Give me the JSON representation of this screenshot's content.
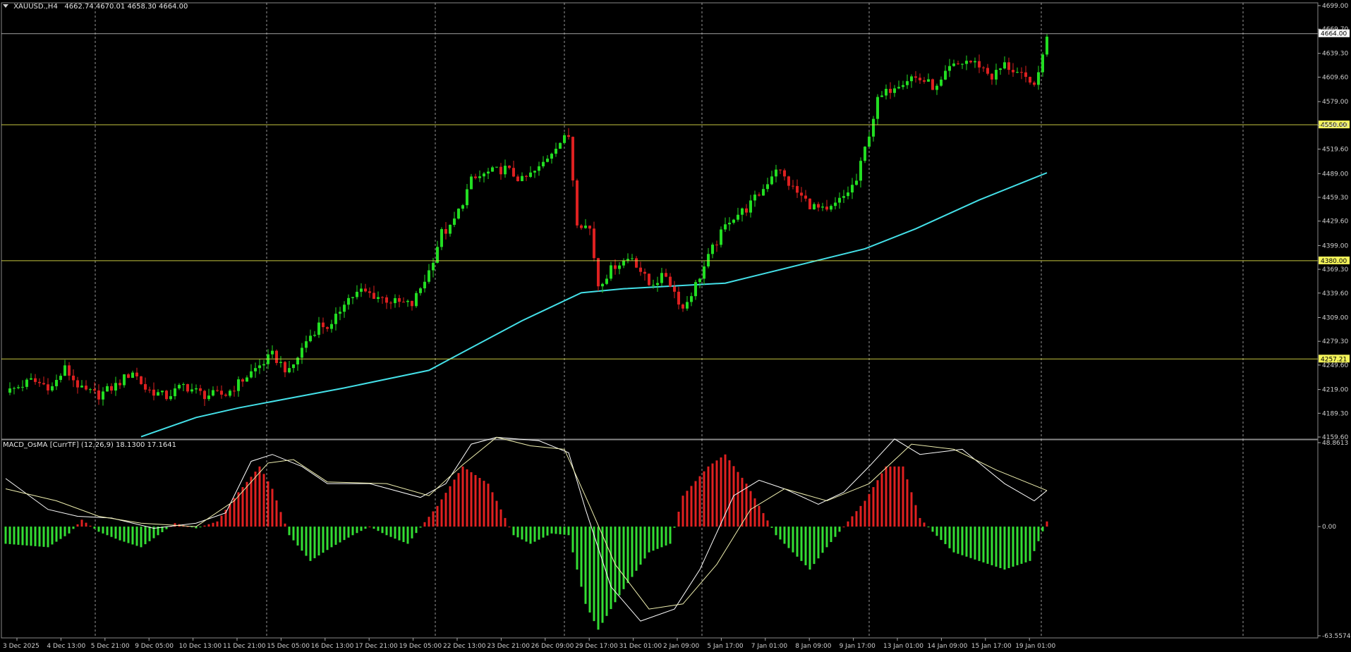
{
  "chart_header": {
    "symbol": "XAUUSD.,H4",
    "ohlc": "4662.74 4670.01 4658.30 4664.00"
  },
  "indicator_header": {
    "label": "MACD_OsMA [CurrTF] (12,26,9) 18.1300 17.1641"
  },
  "colors": {
    "background": "#000000",
    "bull_candle": "#22dd22",
    "bear_candle": "#dd2020",
    "moving_average": "#44e0e8",
    "level_line": "#e8e84a",
    "grid": "#c8c8c8",
    "osma_positive": "#e02020",
    "osma_negative": "#33dd33",
    "macd_line": "#ffffff",
    "signal_line": "#f0f0b0"
  },
  "chart_data": [
    {
      "type": "candlestick",
      "price_axis_ticks": [
        "4699.00",
        "4669.70",
        "4639.30",
        "4609.60",
        "4579.00",
        "4549.40",
        "4519.60",
        "4489.00",
        "4459.30",
        "4429.60",
        "4399.00",
        "4369.30",
        "4339.60",
        "4309.00",
        "4279.30",
        "4249.60",
        "4219.00",
        "4189.30",
        "4159.60"
      ],
      "y_range": [
        4159.6,
        4699.0
      ],
      "level_lines": [
        {
          "value": 4664.0,
          "label": "4664.00",
          "style": "current-price"
        },
        {
          "value": 4550.0,
          "label": "4550.00",
          "style": "yellow"
        },
        {
          "value": 4380.0,
          "label": "4380.00",
          "style": "yellow"
        },
        {
          "value": 4257.21,
          "label": "4257.21",
          "style": "yellow"
        }
      ],
      "time_axis_labels": [
        "3 Dec 2025",
        "4 Dec 13:00",
        "5 Dec 21:00",
        "9 Dec 05:00",
        "10 Dec 13:00",
        "11 Dec 21:00",
        "15 Dec 05:00",
        "16 Dec 13:00",
        "17 Dec 21:00",
        "19 Dec 05:00",
        "22 Dec 13:00",
        "23 Dec 21:00",
        "26 Dec 09:00",
        "29 Dec 17:00",
        "31 Dec 01:00",
        "2 Jan 09:00",
        "5 Jan 17:00",
        "7 Jan 01:00",
        "8 Jan 09:00",
        "9 Jan 17:00",
        "13 Jan 01:00",
        "14 Jan 09:00",
        "15 Jan 17:00",
        "19 Jan 01:00"
      ],
      "close_path": [
        [
          0,
          4215
        ],
        [
          6,
          4230
        ],
        [
          11,
          4222
        ],
        [
          14,
          4245
        ],
        [
          18,
          4218
        ],
        [
          22,
          4212
        ],
        [
          26,
          4224
        ],
        [
          30,
          4242
        ],
        [
          33,
          4220
        ],
        [
          38,
          4210
        ],
        [
          42,
          4224
        ],
        [
          47,
          4212
        ],
        [
          52,
          4213
        ],
        [
          57,
          4236
        ],
        [
          63,
          4262
        ],
        [
          67,
          4240
        ],
        [
          71,
          4280
        ],
        [
          74,
          4300
        ],
        [
          77,
          4297
        ],
        [
          80,
          4330
        ],
        [
          84,
          4342
        ],
        [
          88,
          4335
        ],
        [
          92,
          4328
        ],
        [
          96,
          4325
        ],
        [
          100,
          4367
        ],
        [
          103,
          4415
        ],
        [
          105,
          4420
        ],
        [
          107,
          4442
        ],
        [
          110,
          4480
        ],
        [
          114,
          4490
        ],
        [
          118,
          4495
        ],
        [
          122,
          4480
        ],
        [
          126,
          4495
        ],
        [
          130,
          4525
        ],
        [
          133,
          4536
        ],
        [
          135,
          4430
        ],
        [
          138,
          4420
        ],
        [
          140,
          4350
        ],
        [
          144,
          4375
        ],
        [
          148,
          4385
        ],
        [
          152,
          4350
        ],
        [
          156,
          4362
        ],
        [
          160,
          4320
        ],
        [
          163,
          4350
        ],
        [
          167,
          4395
        ],
        [
          171,
          4432
        ],
        [
          175,
          4445
        ],
        [
          179,
          4470
        ],
        [
          182,
          4497
        ],
        [
          186,
          4470
        ],
        [
          190,
          4450
        ],
        [
          194,
          4440
        ],
        [
          198,
          4460
        ],
        [
          201,
          4480
        ],
        [
          203,
          4520
        ],
        [
          206,
          4580
        ],
        [
          210,
          4600
        ],
        [
          214,
          4610
        ],
        [
          217,
          4605
        ],
        [
          220,
          4595
        ],
        [
          223,
          4620
        ],
        [
          227,
          4630
        ],
        [
          230,
          4625
        ],
        [
          233,
          4610
        ],
        [
          236,
          4625
        ],
        [
          239,
          4615
        ],
        [
          242,
          4600
        ],
        [
          244,
          4610
        ],
        [
          246,
          4664
        ]
      ],
      "moving_average_path": [
        [
          32,
          4160
        ],
        [
          45,
          4184
        ],
        [
          55,
          4196
        ],
        [
          80,
          4221
        ],
        [
          100,
          4243
        ],
        [
          106,
          4260
        ],
        [
          122,
          4305
        ],
        [
          136,
          4340
        ],
        [
          146,
          4345
        ],
        [
          170,
          4352
        ],
        [
          180,
          4365
        ],
        [
          203,
          4395
        ],
        [
          215,
          4420
        ],
        [
          230,
          4456
        ],
        [
          246,
          4490
        ]
      ],
      "x_slots": 248
    },
    {
      "type": "macd_osma",
      "y_range": [
        -63.5574,
        48.8613
      ],
      "axis_ticks": [
        "48.8613",
        "0.00",
        "-63.5574"
      ],
      "osma_path": [
        [
          0,
          -10
        ],
        [
          10,
          -12
        ],
        [
          15,
          -4
        ],
        [
          18,
          4
        ],
        [
          22,
          -3
        ],
        [
          27,
          -8
        ],
        [
          32,
          -12
        ],
        [
          36,
          -5
        ],
        [
          40,
          2
        ],
        [
          45,
          -1
        ],
        [
          50,
          3
        ],
        [
          55,
          20
        ],
        [
          60,
          35
        ],
        [
          63,
          22
        ],
        [
          67,
          -5
        ],
        [
          72,
          -20
        ],
        [
          77,
          -12
        ],
        [
          82,
          -5
        ],
        [
          86,
          0
        ],
        [
          90,
          -5
        ],
        [
          95,
          -10
        ],
        [
          102,
          12
        ],
        [
          108,
          35
        ],
        [
          114,
          25
        ],
        [
          120,
          -5
        ],
        [
          124,
          -10
        ],
        [
          129,
          -4
        ],
        [
          133,
          -5
        ],
        [
          137,
          -45
        ],
        [
          140,
          -60
        ],
        [
          145,
          -40
        ],
        [
          152,
          -15
        ],
        [
          157,
          -10
        ],
        [
          160,
          18
        ],
        [
          166,
          35
        ],
        [
          170,
          42
        ],
        [
          175,
          25
        ],
        [
          182,
          -5
        ],
        [
          186,
          -15
        ],
        [
          190,
          -25
        ],
        [
          194,
          -12
        ],
        [
          198,
          0
        ],
        [
          203,
          15
        ],
        [
          208,
          35
        ],
        [
          212,
          35
        ],
        [
          216,
          5
        ],
        [
          219,
          -3
        ],
        [
          224,
          -15
        ],
        [
          230,
          -20
        ],
        [
          236,
          -25
        ],
        [
          242,
          -20
        ],
        [
          246,
          3
        ]
      ],
      "macd_path": [
        [
          0,
          28
        ],
        [
          10,
          10
        ],
        [
          17,
          6
        ],
        [
          25,
          5
        ],
        [
          35,
          -1
        ],
        [
          45,
          2
        ],
        [
          52,
          8
        ],
        [
          58,
          38
        ],
        [
          63,
          42
        ],
        [
          70,
          35
        ],
        [
          76,
          25
        ],
        [
          86,
          25
        ],
        [
          98,
          17
        ],
        [
          104,
          25
        ],
        [
          110,
          48
        ],
        [
          116,
          52
        ],
        [
          126,
          50
        ],
        [
          133,
          43
        ],
        [
          137,
          10
        ],
        [
          143,
          -35
        ],
        [
          150,
          -55
        ],
        [
          158,
          -48
        ],
        [
          164,
          -25
        ],
        [
          172,
          18
        ],
        [
          178,
          27
        ],
        [
          184,
          22
        ],
        [
          192,
          13
        ],
        [
          198,
          20
        ],
        [
          204,
          35
        ],
        [
          210,
          51
        ],
        [
          216,
          42
        ],
        [
          226,
          45
        ],
        [
          236,
          25
        ],
        [
          243,
          15
        ],
        [
          246,
          21
        ]
      ],
      "signal_path": [
        [
          0,
          22
        ],
        [
          12,
          15
        ],
        [
          22,
          6
        ],
        [
          32,
          2
        ],
        [
          45,
          0
        ],
        [
          54,
          15
        ],
        [
          62,
          37
        ],
        [
          68,
          39
        ],
        [
          76,
          26
        ],
        [
          90,
          25
        ],
        [
          100,
          18
        ],
        [
          108,
          36
        ],
        [
          116,
          52
        ],
        [
          124,
          47
        ],
        [
          132,
          45
        ],
        [
          138,
          12
        ],
        [
          144,
          -22
        ],
        [
          152,
          -48
        ],
        [
          160,
          -45
        ],
        [
          168,
          -22
        ],
        [
          176,
          10
        ],
        [
          184,
          22
        ],
        [
          194,
          15
        ],
        [
          204,
          25
        ],
        [
          214,
          48
        ],
        [
          224,
          45
        ],
        [
          234,
          33
        ],
        [
          246,
          21
        ]
      ]
    }
  ]
}
